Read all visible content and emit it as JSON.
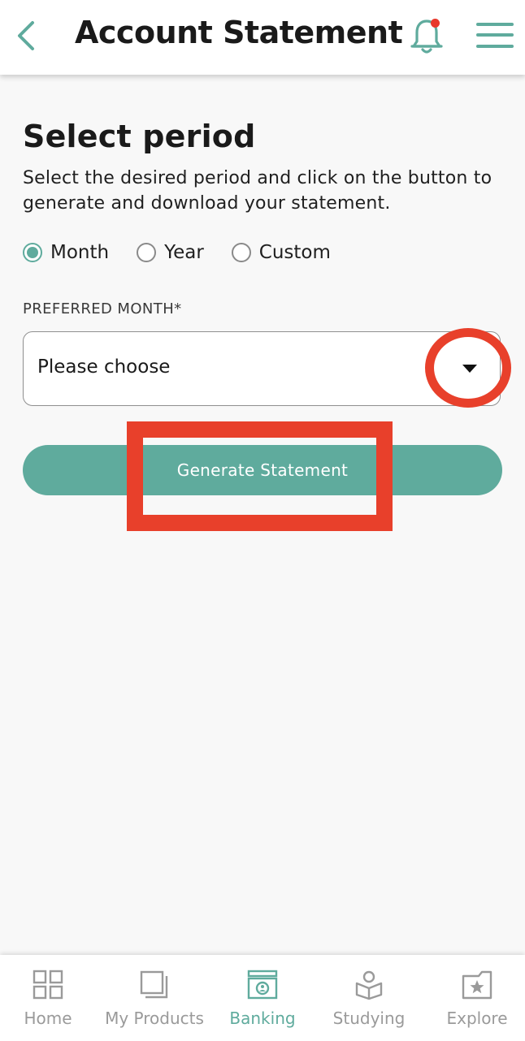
{
  "header": {
    "title": "Account Statement",
    "back_icon": "chevron-left-icon",
    "notification_icon": "bell-icon",
    "menu_icon": "hamburger-menu-icon"
  },
  "content": {
    "section_title": "Select period",
    "description": "Select the desired period and click on the button to generate and download your statement.",
    "period_options": [
      {
        "label": "Month",
        "selected": true
      },
      {
        "label": "Year",
        "selected": false
      },
      {
        "label": "Custom",
        "selected": false
      }
    ],
    "field_label": "PREFERRED MONTH*",
    "select_value": "Please choose",
    "generate_button": "Generate Statement"
  },
  "tabbar": {
    "items": [
      {
        "label": "Home",
        "icon": "grid-icon",
        "active": false
      },
      {
        "label": "My Products",
        "icon": "stacked-cards-icon",
        "active": false
      },
      {
        "label": "Banking",
        "icon": "banking-icon",
        "active": true
      },
      {
        "label": "Studying",
        "icon": "book-person-icon",
        "active": false
      },
      {
        "label": "Explore",
        "icon": "folder-star-icon",
        "active": false
      }
    ]
  },
  "colors": {
    "accent": "#5fab9d",
    "annotation": "#e8402b",
    "notification_dot": "#e8382b",
    "inactive_tab": "#9a9a9a"
  }
}
